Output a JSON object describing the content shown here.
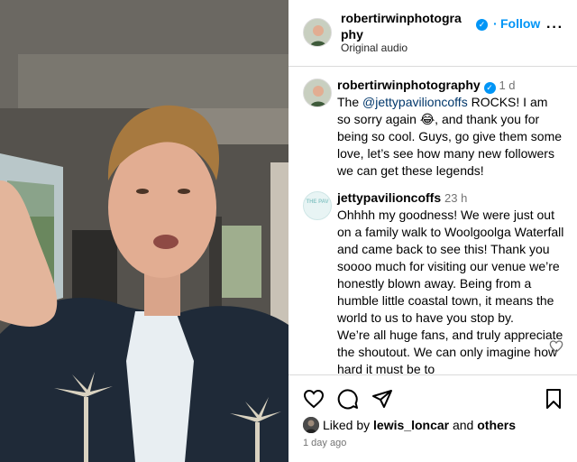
{
  "post": {
    "username": "robertirwinphotography",
    "username_wrapped_a": "robertirwinphotogra",
    "username_wrapped_b": "phy",
    "audio": "Original audio",
    "follow_label": "Follow",
    "dot": "·",
    "more_label": "···"
  },
  "comments": [
    {
      "username": "robertirwinphotography",
      "time": "1 d",
      "text_pre": "The ",
      "mention": "@jettypavilioncoffs",
      "text_post": " ROCKS! I am so sorry again 😂, and thank you for being so cool. Guys, go give them some love, let’s see how many new followers we can get these legends!",
      "verified": true
    },
    {
      "username": "jettypavilioncoffs",
      "time": "23 h",
      "avatar_text": "THE PAV",
      "text": "Ohhhh my goodness! We were just out on a family walk to Woolgoolga Waterfall and came back to see this! Thank you soooo much for visiting our venue we’re honestly blown away. Being from a humble little coastal town, it means the world to us to have you stop by.",
      "text2": "We’re all huge fans, and truly appreciate the shoutout. We can only imagine how hard it must be to"
    }
  ],
  "likes": {
    "prefix": "Liked by ",
    "user": "lewis_loncar",
    "middle": " and ",
    "others": "others",
    "ago": "1 day ago"
  },
  "icons": {
    "heart": "heart-icon",
    "comment": "comment-icon",
    "share": "share-icon",
    "bookmark": "bookmark-icon",
    "verified": "verified-badge-icon"
  },
  "colors": {
    "accent": "#0095f6",
    "muted": "#737373",
    "mention": "#00376b"
  }
}
